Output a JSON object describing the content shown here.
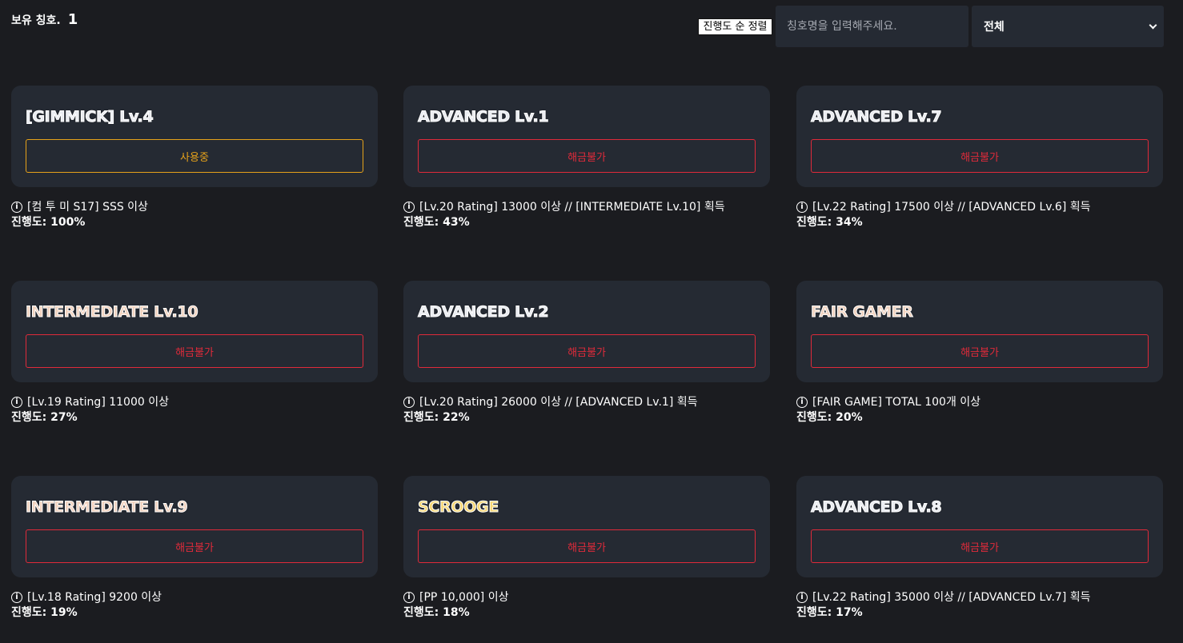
{
  "header": {
    "owned_label": "보유 칭호.",
    "owned_count": "1",
    "sort_button": "진행도 순 정렬",
    "search_placeholder": "칭호명을 입력해주세요.",
    "filter_selected": "전체"
  },
  "cards": [
    {
      "title": "[GIMMICK] Lv.4",
      "title_color": "#e9ebf0",
      "status": "사용중",
      "status_type": "inuse",
      "requirement": "[컴 투 미 S17] SSS 이상",
      "progress": "진행도: 100%"
    },
    {
      "title": "ADVANCED Lv.1",
      "title_color": "#e9ebf0",
      "status": "해금불가",
      "status_type": "locked",
      "requirement": "[Lv.20 Rating] 13000 이상 // [INTERMEDIATE Lv.10] 획득",
      "progress": "진행도: 43%"
    },
    {
      "title": "ADVANCED Lv.7",
      "title_color": "#e9ebf0",
      "status": "해금불가",
      "status_type": "locked",
      "requirement": "[Lv.22 Rating] 17500 이상 // [ADVANCED Lv.6] 획득",
      "progress": "진행도: 34%"
    },
    {
      "title": "INTERMEDIATE Lv.10",
      "title_color": "#f1d2bf",
      "status": "해금불가",
      "status_type": "locked",
      "requirement": "[Lv.19 Rating] 11000 이상",
      "progress": "진행도: 27%"
    },
    {
      "title": "ADVANCED Lv.2",
      "title_color": "#e9ebf0",
      "status": "해금불가",
      "status_type": "locked",
      "requirement": "[Lv.20 Rating] 26000 이상 // [ADVANCED Lv.1] 획득",
      "progress": "진행도: 22%"
    },
    {
      "title": "FAIR GAMER",
      "title_color": "#f1d2bf",
      "status": "해금불가",
      "status_type": "locked",
      "requirement": "[FAIR GAME] TOTAL 100개 이상",
      "progress": "진행도: 20%"
    },
    {
      "title": "INTERMEDIATE Lv.9",
      "title_color": "#f1d2bf",
      "status": "해금불가",
      "status_type": "locked",
      "requirement": "[Lv.18 Rating] 9200 이상",
      "progress": "진행도: 19%"
    },
    {
      "title": "SCROOGE",
      "title_color": "#f7d774",
      "status": "해금불가",
      "status_type": "locked",
      "requirement": "[PP 10,000] 이상",
      "progress": "진행도: 18%"
    },
    {
      "title": "ADVANCED Lv.8",
      "title_color": "#e9ebf0",
      "status": "해금불가",
      "status_type": "locked",
      "requirement": "[Lv.22 Rating] 35000 이상 // [ADVANCED Lv.7] 획득",
      "progress": "진행도: 17%"
    }
  ],
  "colors": {
    "background": "#1b1c20",
    "card": "#252a33",
    "locked": "#e02a3a",
    "inuse": "#e6a21a"
  }
}
